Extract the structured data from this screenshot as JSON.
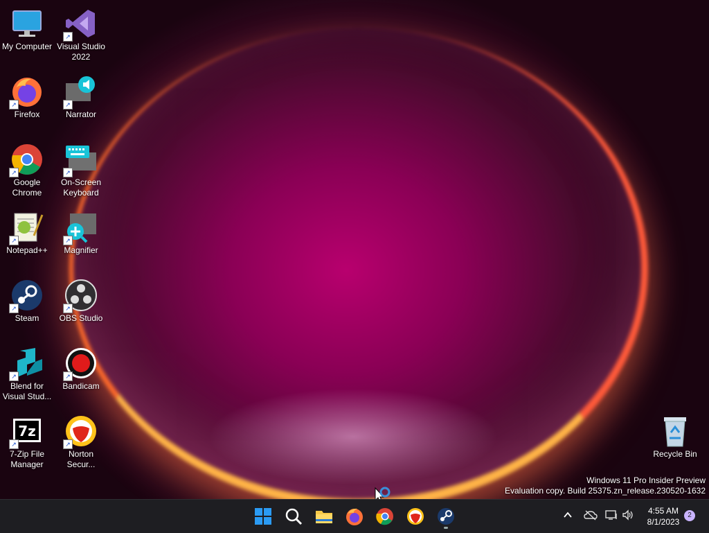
{
  "desktop_icons": [
    {
      "label": "My Computer",
      "icon": "computer-icon"
    },
    {
      "label": "Visual Studio 2022",
      "icon": "visual-studio-icon"
    },
    {
      "label": "Firefox",
      "icon": "firefox-icon"
    },
    {
      "label": "Narrator",
      "icon": "narrator-icon"
    },
    {
      "label": "Google Chrome",
      "icon": "chrome-icon"
    },
    {
      "label": "On-Screen Keyboard",
      "icon": "keyboard-icon"
    },
    {
      "label": "Notepad++",
      "icon": "notepadpp-icon"
    },
    {
      "label": "Magnifier",
      "icon": "magnifier-icon"
    },
    {
      "label": "Steam",
      "icon": "steam-icon"
    },
    {
      "label": "OBS Studio",
      "icon": "obs-icon"
    },
    {
      "label": "Blend for Visual Stud...",
      "icon": "blend-icon"
    },
    {
      "label": "Bandicam",
      "icon": "bandicam-icon"
    },
    {
      "label": "7-Zip File Manager",
      "icon": "7zip-icon"
    },
    {
      "label": "Norton Secur...",
      "icon": "norton-icon"
    },
    {
      "label": "Recycle Bin",
      "icon": "recycle-bin-icon"
    }
  ],
  "watermark": {
    "line1": "Windows 11 Pro Insider Preview",
    "line2": "Evaluation copy. Build 25375.zn_release.230520-1632"
  },
  "taskbar": {
    "apps": [
      "start-icon",
      "search-icon",
      "file-explorer-icon",
      "firefox-icon",
      "chrome-icon",
      "norton-icon",
      "steam-icon"
    ],
    "clock_time": "4:55 AM",
    "clock_date": "8/1/2023",
    "notification_count": "2"
  }
}
